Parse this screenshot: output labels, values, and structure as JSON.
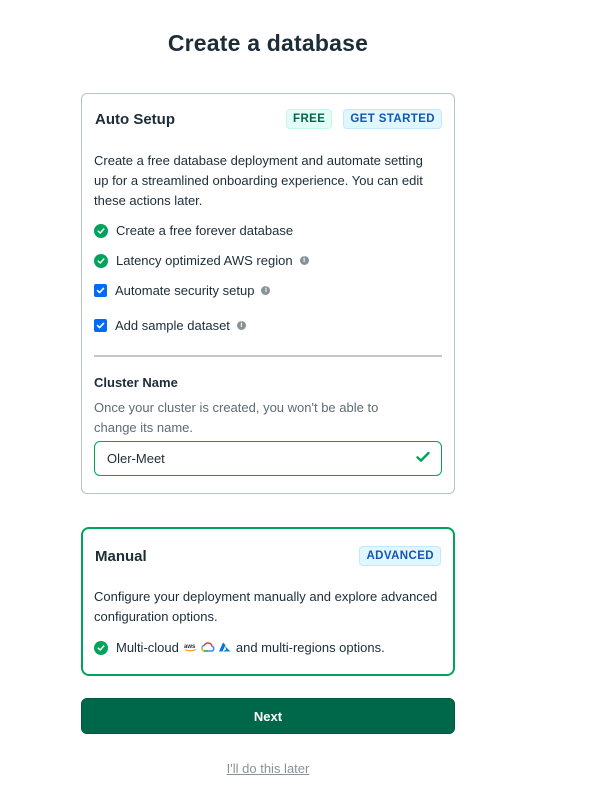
{
  "page": {
    "title": "Create a database"
  },
  "auto_setup": {
    "title": "Auto Setup",
    "badges": {
      "free": "FREE",
      "get_started": "GET STARTED"
    },
    "description": "Create a free database deployment and automate setting up for a streamlined onboarding experience. You can edit these actions later.",
    "items": [
      {
        "label": "Create a free forever database",
        "kind": "check-circle",
        "info": false
      },
      {
        "label": "Latency optimized AWS region",
        "kind": "check-circle",
        "info": true
      },
      {
        "label": "Automate security setup",
        "kind": "checkbox",
        "checked": true,
        "info": true
      },
      {
        "label": "Add sample dataset",
        "kind": "checkbox",
        "checked": true,
        "info": true
      }
    ],
    "cluster": {
      "label": "Cluster Name",
      "description": "Once your cluster is created, you won't be able to change its name.",
      "value": "Oler-Meet"
    }
  },
  "manual": {
    "title": "Manual",
    "badge": "ADVANCED",
    "description": "Configure your deployment manually and explore advanced configuration options.",
    "item_prefix": "Multi-cloud",
    "item_suffix": "and multi-regions options.",
    "cloud_icons": [
      "aws-icon",
      "google-cloud-icon",
      "azure-icon"
    ]
  },
  "actions": {
    "next": "Next",
    "later": "I'll do this later"
  },
  "colors": {
    "primary": "#00684a",
    "accent_green": "#00a35c",
    "checkbox_blue": "#016bf8",
    "badge_blue": "#1254b7"
  }
}
